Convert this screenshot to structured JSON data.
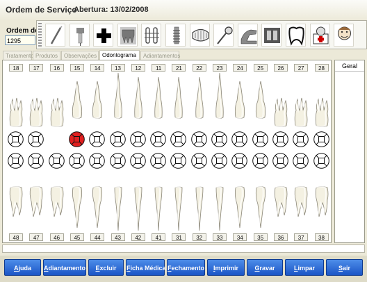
{
  "window": {
    "title": "Ordem de Serviço",
    "abertura": "Abertura: 13/02/2008"
  },
  "ordem": {
    "label": "Ordem de Serviço",
    "value": "1295"
  },
  "toolbar_icons": [
    "scalpel-icon",
    "drill-icon",
    "first-aid-icon",
    "tooth-x-ray-icon",
    "braces-icon",
    "implant-screw-icon",
    "dentures-icon",
    "dental-mirror-icon",
    "dental-chair-icon",
    "x-ray-film-icon",
    "tooth-crown-icon",
    "dental-kit-icon",
    "patient-icon"
  ],
  "tabs": [
    "Tratamento",
    "Produtos",
    "Observações",
    "Odontograma",
    "Adiantamentos"
  ],
  "active_tab": "Odontograma",
  "upper_teeth": [
    "18",
    "17",
    "16",
    "15",
    "14",
    "13",
    "12",
    "11",
    "21",
    "22",
    "23",
    "24",
    "25",
    "26",
    "27",
    "28"
  ],
  "lower_teeth": [
    "48",
    "47",
    "46",
    "45",
    "44",
    "43",
    "42",
    "41",
    "31",
    "32",
    "33",
    "34",
    "35",
    "36",
    "37",
    "38"
  ],
  "geral": "Geral",
  "marked_tooth": "15",
  "marked_color": "#e02020",
  "buttons": [
    {
      "label": "Ajuda",
      "key": "A"
    },
    {
      "label": "Adiantamento",
      "key": "A"
    },
    {
      "label": "Excluir",
      "key": "E"
    },
    {
      "label": "Ficha Médica",
      "key": "F"
    },
    {
      "label": "Fechamento",
      "key": "F"
    },
    {
      "label": "Imprimir",
      "key": "I"
    },
    {
      "label": "Gravar",
      "key": "G"
    },
    {
      "label": "Limpar",
      "key": "L"
    },
    {
      "label": "Sair",
      "key": "S"
    }
  ]
}
